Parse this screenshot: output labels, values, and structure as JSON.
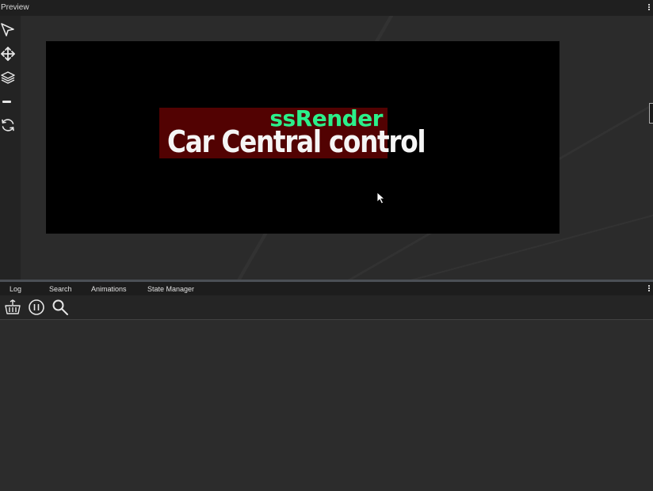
{
  "preview": {
    "title": "Preview",
    "tools": [
      "select-arrow-icon",
      "move-icon",
      "layers-icon",
      "minus-icon",
      "refresh-icon"
    ]
  },
  "canvas": {
    "brand_text": "ssRender",
    "headline": "Car Central control",
    "brand_color": "#2bf08a",
    "banner_color": "#520202"
  },
  "bottom_panel": {
    "tabs": [
      "Log",
      "Search",
      "Animations",
      "State Manager"
    ],
    "toolbar": [
      "clear-basket-icon",
      "pause-icon",
      "search-icon"
    ]
  }
}
